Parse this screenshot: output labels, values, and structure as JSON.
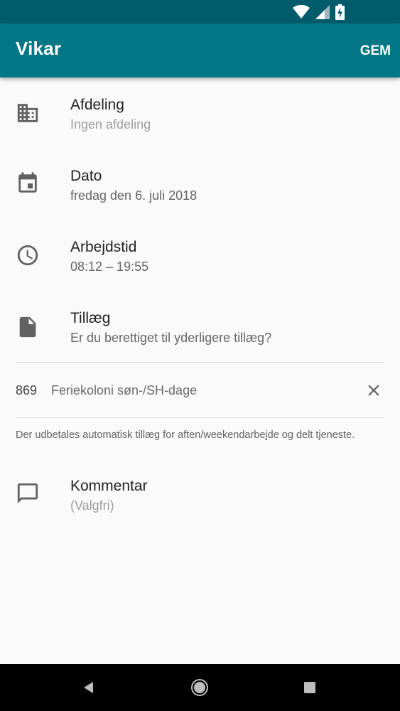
{
  "status_bar": {
    "icons": [
      "wifi-icon",
      "cell-signal-icon",
      "battery-charging-icon"
    ]
  },
  "app_bar": {
    "title": "Vikar",
    "action_label": "GEM"
  },
  "form": {
    "department": {
      "label": "Afdeling",
      "value": "Ingen afdeling",
      "icon": "building-icon"
    },
    "date": {
      "label": "Dato",
      "value": "fredag den 6. juli 2018",
      "icon": "calendar-icon"
    },
    "work_time": {
      "label": "Arbejdstid",
      "value": "08:12 – 19:55",
      "icon": "clock-icon"
    },
    "allowance": {
      "label": "Tillæg",
      "value": "Er du berettiget til yderligere tillæg?",
      "icon": "document-icon"
    },
    "selected_allowance": {
      "code": "869",
      "name": "Feriekoloni søn-/SH-dage",
      "remove_icon": "close-icon"
    },
    "note": "Der udbetales automatisk tillæg for aften/weekendarbejde og delt tjeneste.",
    "comment": {
      "label": "Kommentar",
      "value": "(Valgfri)",
      "icon": "comment-icon"
    }
  },
  "nav_bar": {
    "buttons": [
      "back-icon",
      "home-icon",
      "recents-icon"
    ]
  },
  "colors": {
    "status_bar": "#005b6b",
    "app_bar": "#017685",
    "background": "#fafafa",
    "icon": "#616161"
  }
}
